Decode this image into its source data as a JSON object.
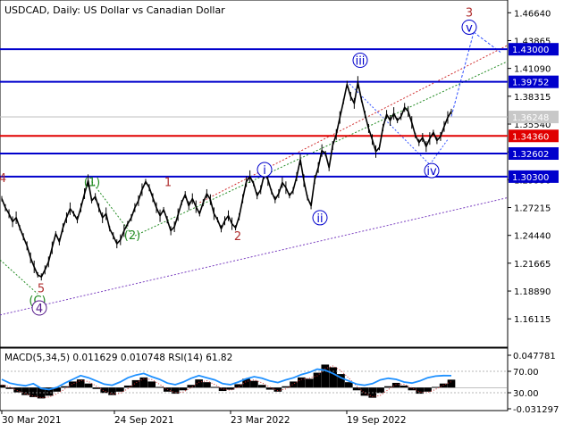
{
  "chart_data": [
    {
      "type": "line",
      "title": "USDCAD, Daily:  US Dollar vs Canadian Dollar",
      "x_dates": [
        "30 Mar 2021",
        "24 Sep 2021",
        "23 Mar 2022",
        "19 Sep 2022"
      ],
      "y_ticks": [
        "1.46640",
        "1.43865",
        "1.41090",
        "1.38315",
        "1.35540",
        "1.32765",
        "1.29990",
        "1.27215",
        "1.24440",
        "1.21665",
        "1.18890",
        "1.16115"
      ],
      "ylim": [
        1.14,
        1.472
      ],
      "grid": false,
      "last_price": {
        "label": "1.36248",
        "value": 1.36248
      },
      "levels": [
        {
          "label": "1.43000",
          "value": 1.43,
          "color": "#0000cc"
        },
        {
          "label": "1.39752",
          "value": 1.39752,
          "color": "#0000cc"
        },
        {
          "label": "1.34360",
          "value": 1.3436,
          "color": "#e00000"
        },
        {
          "label": "1.32602",
          "value": 1.32602,
          "color": "#0000cc"
        },
        {
          "label": "1.30300",
          "value": 1.303,
          "color": "#0000cc"
        }
      ],
      "series": [
        {
          "values": [
            1.281,
            1.272,
            1.266,
            1.258,
            1.262,
            1.252,
            1.243,
            1.234,
            1.222,
            1.213,
            1.205,
            1.203,
            1.21,
            1.218,
            1.232,
            1.246,
            1.238,
            1.252,
            1.262,
            1.271,
            1.266,
            1.26,
            1.272,
            1.286,
            1.299,
            1.279,
            1.283,
            1.272,
            1.262,
            1.266,
            1.251,
            1.244,
            1.236,
            1.24,
            1.249,
            1.256,
            1.262,
            1.272,
            1.279,
            1.29,
            1.298,
            1.292,
            1.282,
            1.272,
            1.264,
            1.27,
            1.26,
            1.249,
            1.253,
            1.265,
            1.277,
            1.285,
            1.274,
            1.281,
            1.273,
            1.266,
            1.277,
            1.286,
            1.28,
            1.266,
            1.26,
            1.251,
            1.259,
            1.264,
            1.256,
            1.252,
            1.263,
            1.281,
            1.298,
            1.303,
            1.296,
            1.284,
            1.29,
            1.306,
            1.3,
            1.288,
            1.28,
            1.286,
            1.297,
            1.292,
            1.284,
            1.289,
            1.303,
            1.32,
            1.299,
            1.282,
            1.274,
            1.3,
            1.312,
            1.329,
            1.326,
            1.312,
            1.334,
            1.345,
            1.362,
            1.378,
            1.395,
            1.383,
            1.376,
            1.397,
            1.38,
            1.365,
            1.351,
            1.34,
            1.328,
            1.332,
            1.352,
            1.365,
            1.359,
            1.366,
            1.359,
            1.363,
            1.372,
            1.368,
            1.357,
            1.344,
            1.337,
            1.342,
            1.333,
            1.341,
            1.347,
            1.339,
            1.343,
            1.353,
            1.362,
            1.368
          ]
        }
      ],
      "wave_labels": [
        {
          "text": "(1)",
          "value": 1.298,
          "color": "#228b22"
        },
        {
          "text": "(2)",
          "value": 1.245,
          "color": "#228b22"
        },
        {
          "text": "(C)",
          "value": 1.18,
          "color": "#228b22"
        },
        {
          "text": "1",
          "value": 1.298,
          "color": "#b03030"
        },
        {
          "text": "2",
          "value": 1.244,
          "color": "#b03030"
        },
        {
          "text": "3",
          "value": 1.467,
          "color": "#b03030"
        },
        {
          "text": "5",
          "value": 1.192,
          "color": "#b03030"
        },
        {
          "text": "4",
          "value": 1.302,
          "color": "#b03030"
        },
        {
          "text": "4",
          "value": 1.172,
          "color": "#551a8b"
        },
        {
          "text": "i",
          "value": 1.31,
          "color": "#0000cc"
        },
        {
          "text": "ii",
          "value": 1.262,
          "color": "#0000cc"
        },
        {
          "text": "iii",
          "value": 1.419,
          "color": "#0000cc"
        },
        {
          "text": "iv",
          "value": 1.309,
          "color": "#0000cc"
        },
        {
          "text": "v",
          "value": 1.452,
          "color": "#0000cc"
        }
      ]
    },
    {
      "type": "line",
      "title": "MACD(5,34,5) 0.011629 0.010748 RSI(14) 61.82",
      "y_ticks": [
        "0.047781",
        "70.00",
        "30.00",
        "-0.031297"
      ],
      "ylim": [
        -0.031297,
        0.047781
      ],
      "series": [
        {
          "name": "MACD",
          "values": [
            0.004,
            -0.002,
            -0.007,
            -0.011,
            -0.014,
            -0.016,
            -0.012,
            -0.006,
            0.002,
            0.009,
            0.012,
            0.006,
            -0.002,
            -0.008,
            -0.011,
            -0.006,
            0.003,
            0.011,
            0.015,
            0.009,
            0.001,
            -0.006,
            -0.009,
            -0.004,
            0.004,
            0.012,
            0.008,
            0.001,
            -0.005,
            -0.003,
            0.005,
            0.013,
            0.01,
            0.004,
            -0.003,
            -0.006,
            0.002,
            0.009,
            0.015,
            0.013,
            0.022,
            0.034,
            0.03,
            0.02,
            0.008,
            -0.004,
            -0.012,
            -0.015,
            -0.008,
            0.002,
            0.007,
            0.003,
            -0.004,
            -0.009,
            -0.006,
            0.001,
            0.006,
            0.0117
          ]
        },
        {
          "name": "RSI",
          "values": [
            55,
            48,
            45,
            43,
            47,
            38,
            36,
            40,
            48,
            55,
            62,
            58,
            52,
            46,
            44,
            50,
            58,
            63,
            66,
            60,
            55,
            48,
            45,
            50,
            57,
            62,
            58,
            54,
            47,
            45,
            50,
            56,
            60,
            57,
            52,
            49,
            54,
            58,
            64,
            68,
            74,
            72,
            66,
            58,
            52,
            46,
            44,
            47,
            54,
            57,
            55,
            50,
            48,
            52,
            58,
            61,
            62,
            61.82
          ]
        }
      ]
    }
  ]
}
